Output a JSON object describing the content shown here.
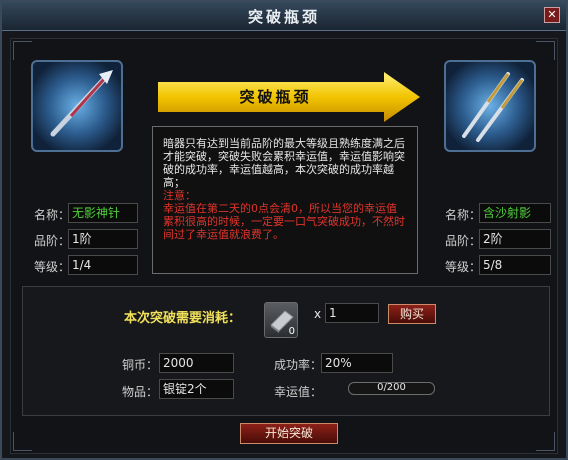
{
  "window": {
    "title": "突破瓶颈",
    "close_label": "✕"
  },
  "banner": {
    "label": "突破瓶颈"
  },
  "description": {
    "text": "暗器只有达到当前品阶的最大等级且熟练度满之后才能突破，突破失败会累积幸运值，幸运值影响突破的成功率，幸运值越高，本次突破的成功率越高；",
    "note_title": "注意：",
    "note_text": "幸运值在第二天的0点会清0，所以当您的幸运值累积很高的时候，一定要一口气突破成功，不然时间过了幸运值就浪费了。"
  },
  "left": {
    "name_label": "名称：",
    "name_value": "无影神针",
    "grade_label": "品阶：",
    "grade_value": "1阶",
    "level_label": "等级：",
    "level_value": "1/4"
  },
  "right": {
    "name_label": "名称：",
    "name_value": "含沙射影",
    "grade_label": "品阶：",
    "grade_value": "2阶",
    "level_label": "等级：",
    "level_value": "5/8"
  },
  "cost": {
    "title": "本次突破需要消耗：",
    "item_count": "0",
    "times_label": "x",
    "quantity_value": "1",
    "buy_label": "购买",
    "copper_label": "铜币：",
    "copper_value": "2000",
    "rate_label": "成功率：",
    "rate_value": "20%",
    "item_label": "物品：",
    "item_value": "银锭2个",
    "luck_label": "幸运值：",
    "luck_value": "0/200",
    "luck_fraction": 0
  },
  "start_label": "开始突破",
  "colors": {
    "accent_arrow": "#f2c400",
    "name_green": "#4fcf3c",
    "warning_red": "#e0342c"
  }
}
